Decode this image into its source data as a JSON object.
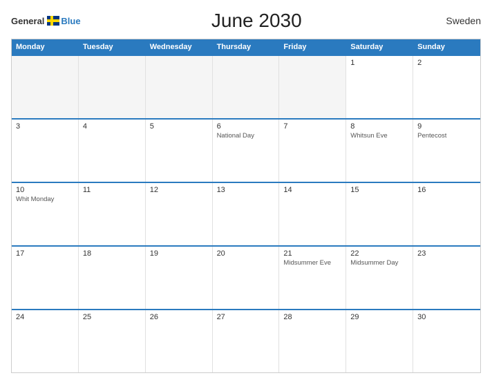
{
  "header": {
    "logo_general": "General",
    "logo_blue": "Blue",
    "title": "June 2030",
    "country": "Sweden"
  },
  "day_headers": [
    "Monday",
    "Tuesday",
    "Wednesday",
    "Thursday",
    "Friday",
    "Saturday",
    "Sunday"
  ],
  "weeks": [
    [
      {
        "day": "",
        "holiday": "",
        "empty": true
      },
      {
        "day": "",
        "holiday": "",
        "empty": true
      },
      {
        "day": "",
        "holiday": "",
        "empty": true
      },
      {
        "day": "",
        "holiday": "",
        "empty": true
      },
      {
        "day": "",
        "holiday": "",
        "empty": true
      },
      {
        "day": "1",
        "holiday": ""
      },
      {
        "day": "2",
        "holiday": ""
      }
    ],
    [
      {
        "day": "3",
        "holiday": ""
      },
      {
        "day": "4",
        "holiday": ""
      },
      {
        "day": "5",
        "holiday": ""
      },
      {
        "day": "6",
        "holiday": "National Day"
      },
      {
        "day": "7",
        "holiday": ""
      },
      {
        "day": "8",
        "holiday": "Whitsun Eve"
      },
      {
        "day": "9",
        "holiday": "Pentecost"
      }
    ],
    [
      {
        "day": "10",
        "holiday": "Whit Monday"
      },
      {
        "day": "11",
        "holiday": ""
      },
      {
        "day": "12",
        "holiday": ""
      },
      {
        "day": "13",
        "holiday": ""
      },
      {
        "day": "14",
        "holiday": ""
      },
      {
        "day": "15",
        "holiday": ""
      },
      {
        "day": "16",
        "holiday": ""
      }
    ],
    [
      {
        "day": "17",
        "holiday": ""
      },
      {
        "day": "18",
        "holiday": ""
      },
      {
        "day": "19",
        "holiday": ""
      },
      {
        "day": "20",
        "holiday": ""
      },
      {
        "day": "21",
        "holiday": "Midsummer Eve"
      },
      {
        "day": "22",
        "holiday": "Midsummer Day"
      },
      {
        "day": "23",
        "holiday": ""
      }
    ],
    [
      {
        "day": "24",
        "holiday": ""
      },
      {
        "day": "25",
        "holiday": ""
      },
      {
        "day": "26",
        "holiday": ""
      },
      {
        "day": "27",
        "holiday": ""
      },
      {
        "day": "28",
        "holiday": ""
      },
      {
        "day": "29",
        "holiday": ""
      },
      {
        "day": "30",
        "holiday": ""
      }
    ]
  ],
  "colors": {
    "header_bg": "#2a7abf",
    "header_text": "#ffffff",
    "border": "#2a7abf",
    "empty_bg": "#f5f5f5"
  }
}
